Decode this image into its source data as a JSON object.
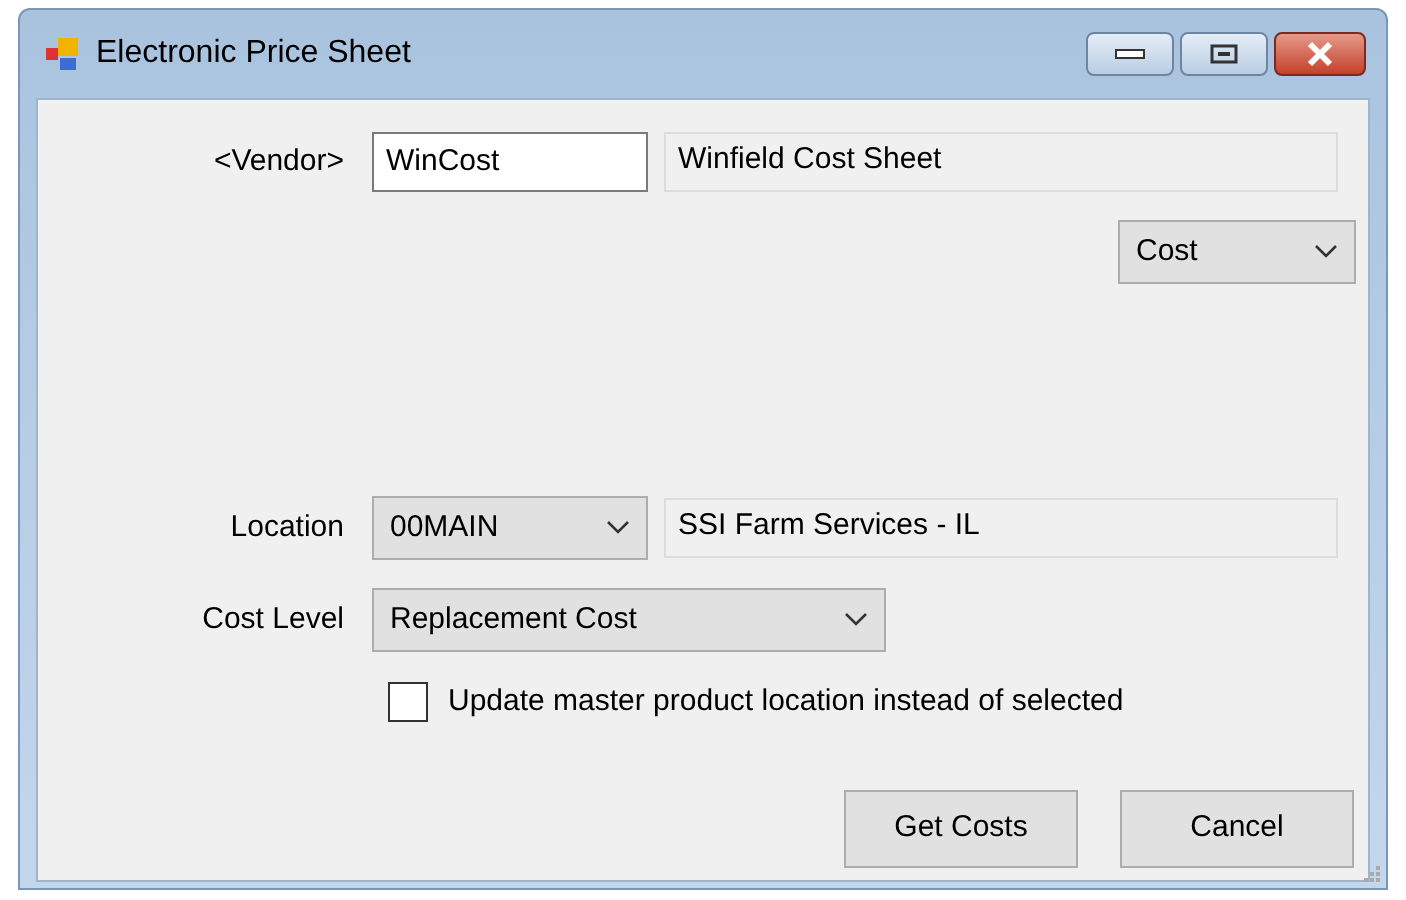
{
  "window": {
    "title": "Electronic Price Sheet"
  },
  "vendor": {
    "label": "<Vendor>",
    "code": "WinCost",
    "name": "Winfield Cost Sheet"
  },
  "cost_type": {
    "value": "Cost"
  },
  "location": {
    "label": "Location",
    "code": "00MAIN",
    "name": "SSI Farm Services - IL"
  },
  "cost_level": {
    "label": "Cost Level",
    "value": "Replacement Cost"
  },
  "update_master": {
    "label": "Update master product location instead of selected",
    "checked": false
  },
  "buttons": [
    "Get Costs",
    "Cancel"
  ]
}
